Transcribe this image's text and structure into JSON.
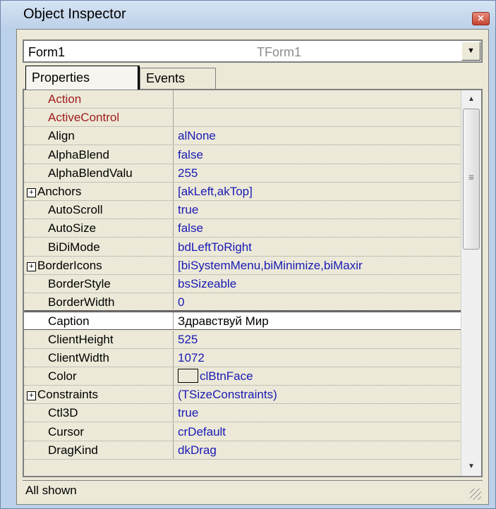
{
  "window": {
    "title": "Object Inspector",
    "close_icon": "close-icon"
  },
  "object_selector": {
    "name": "Form1",
    "type": "TForm1"
  },
  "tabs": [
    {
      "label": "Properties",
      "active": true
    },
    {
      "label": "Events",
      "active": false
    }
  ],
  "properties": [
    {
      "name": "Action",
      "value": "",
      "kind": "ref"
    },
    {
      "name": "ActiveControl",
      "value": "",
      "kind": "ref"
    },
    {
      "name": "Align",
      "value": "alNone"
    },
    {
      "name": "AlphaBlend",
      "value": "false"
    },
    {
      "name": "AlphaBlendValu",
      "value": "255"
    },
    {
      "name": "Anchors",
      "value": "[akLeft,akTop]",
      "expandable": true
    },
    {
      "name": "AutoScroll",
      "value": "true"
    },
    {
      "name": "AutoSize",
      "value": "false"
    },
    {
      "name": "BiDiMode",
      "value": "bdLeftToRight"
    },
    {
      "name": "BorderIcons",
      "value": "[biSystemMenu,biMinimize,biMaxir",
      "expandable": true
    },
    {
      "name": "BorderStyle",
      "value": "bsSizeable"
    },
    {
      "name": "BorderWidth",
      "value": "0"
    },
    {
      "name": "Caption",
      "value": "Здравствуй Мир",
      "selected": true
    },
    {
      "name": "ClientHeight",
      "value": "525"
    },
    {
      "name": "ClientWidth",
      "value": "1072"
    },
    {
      "name": "Color",
      "value": "clBtnFace",
      "swatch": true
    },
    {
      "name": "Constraints",
      "value": "(TSizeConstraints)",
      "expandable": true
    },
    {
      "name": "Ctl3D",
      "value": "true"
    },
    {
      "name": "Cursor",
      "value": "crDefault"
    },
    {
      "name": "DragKind",
      "value": "dkDrag"
    }
  ],
  "status": {
    "text": "All shown"
  },
  "colors": {
    "ref_property": "#9e1b1b",
    "value_text": "#1a1ab4",
    "panel": "#ece9d8"
  }
}
